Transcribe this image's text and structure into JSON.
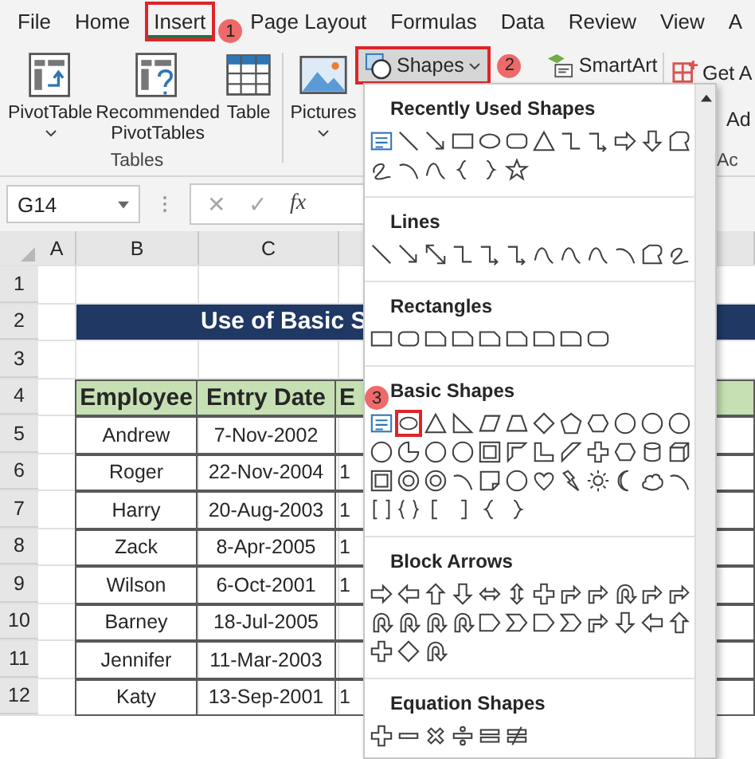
{
  "tabs": [
    {
      "label": "File",
      "selected": false
    },
    {
      "label": "Home",
      "selected": false
    },
    {
      "label": "Insert",
      "selected": true,
      "callout": "1"
    },
    {
      "label": "Page Layout",
      "selected": false
    },
    {
      "label": "Formulas",
      "selected": false
    },
    {
      "label": "Data",
      "selected": false
    },
    {
      "label": "Review",
      "selected": false
    },
    {
      "label": "View",
      "selected": false
    },
    {
      "label": "A",
      "selected": false
    }
  ],
  "ribbon": {
    "tables_group": {
      "label": "Tables",
      "buttons": [
        {
          "kind": "pivot-table",
          "label": "PivotTable",
          "caret": true
        },
        {
          "kind": "recommended",
          "label": "Recommended PivotTables",
          "caret": false
        },
        {
          "kind": "table",
          "label": "Table",
          "caret": false
        }
      ]
    },
    "pictures": {
      "label": "Pictures",
      "caret": true
    },
    "shapes": {
      "label": "Shapes",
      "pressed": true,
      "callout": "2"
    },
    "smartart": {
      "label": "SmartArt"
    },
    "addins": {
      "lines": [
        "Get A",
        "Ad"
      ],
      "group_label": "Ac"
    }
  },
  "formula_bar": {
    "name_box": "G14",
    "cancel": "✕",
    "enter": "✓",
    "function": "fx"
  },
  "sheet": {
    "columns": [
      "A",
      "B",
      "C"
    ],
    "rows": [
      {
        "number": "1",
        "kind": "empty"
      },
      {
        "number": "2",
        "kind": "title",
        "text": "Use of Basic S"
      },
      {
        "number": "3",
        "kind": "empty"
      },
      {
        "number": "4",
        "kind": "header",
        "cells": [
          "Employee",
          "Entry Date",
          "E"
        ]
      },
      {
        "number": "5",
        "kind": "data",
        "cells": [
          "Andrew",
          "7-Nov-2002"
        ]
      },
      {
        "number": "6",
        "kind": "data",
        "cells": [
          "Roger",
          "22-Nov-2004",
          "1"
        ]
      },
      {
        "number": "7",
        "kind": "data",
        "cells": [
          "Harry",
          "20-Aug-2003",
          "1"
        ]
      },
      {
        "number": "8",
        "kind": "data",
        "cells": [
          "Zack",
          "8-Apr-2005",
          "1"
        ]
      },
      {
        "number": "9",
        "kind": "data",
        "cells": [
          "Wilson",
          "6-Oct-2001",
          "1"
        ]
      },
      {
        "number": "10",
        "kind": "data",
        "cells": [
          "Barney",
          "18-Jul-2005"
        ]
      },
      {
        "number": "11",
        "kind": "data",
        "cells": [
          "Jennifer",
          "11-Mar-2003"
        ]
      },
      {
        "number": "12",
        "kind": "data",
        "cells": [
          "Katy",
          "13-Sep-2001",
          "1"
        ]
      }
    ]
  },
  "shapes_menu": {
    "sections": [
      {
        "kind": "recent",
        "heading": "Recently Used Shapes"
      },
      {
        "kind": "lines",
        "heading": "Lines"
      },
      {
        "kind": "rectangles",
        "heading": "Rectangles"
      },
      {
        "kind": "basic",
        "heading": "Basic Shapes",
        "callout": "3"
      },
      {
        "kind": "block-arrows",
        "heading": "Block Arrows"
      },
      {
        "kind": "equation",
        "heading": "Equation Shapes"
      }
    ]
  }
}
